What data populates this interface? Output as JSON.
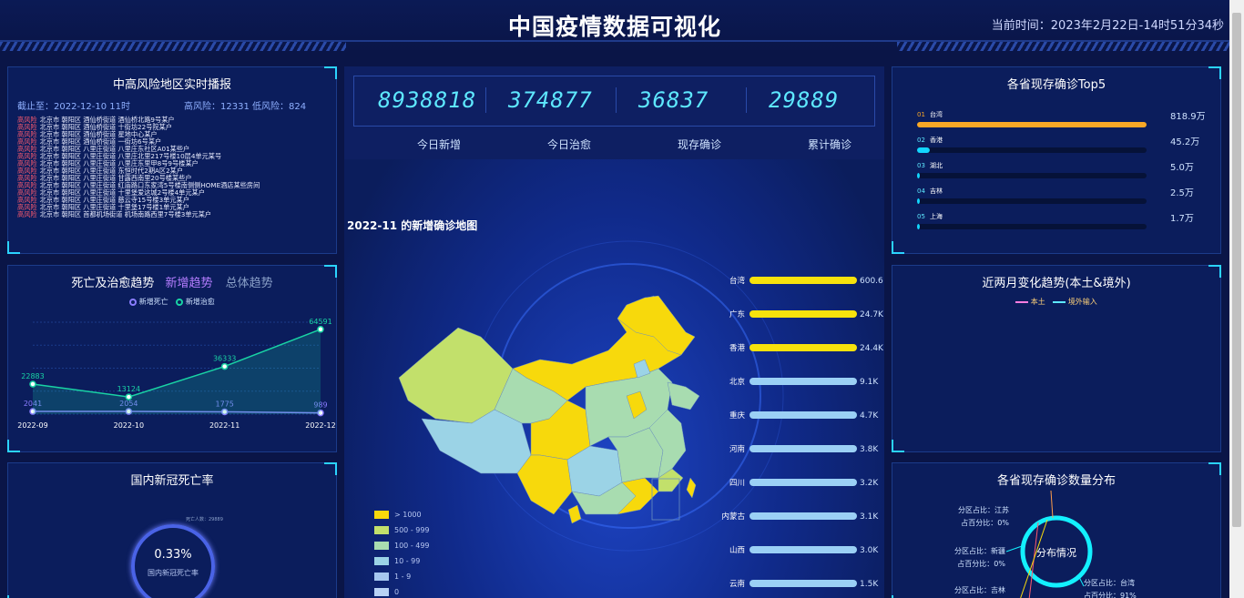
{
  "header": {
    "title": "中国疫情数据可视化",
    "time": "当前时间：2023年2月22日-14时51分34秒"
  },
  "risk": {
    "title": "中高风险地区实时播报",
    "deadline": "截止至：2022-12-10 11时",
    "counts": "高风险：12331 低风险：824",
    "rows": [
      {
        "level": "高风险",
        "place": "北京市 朝阳区 酒仙桥街道 酒仙桥北路9号某户"
      },
      {
        "level": "高风险",
        "place": "北京市 朝阳区 酒仙桥街道 十街坊22号院某户"
      },
      {
        "level": "高风险",
        "place": "北京市 朝阳区 酒仙桥街道 星地中心某户"
      },
      {
        "level": "高风险",
        "place": "北京市 朝阳区 酒仙桥街道 一街坊6号某户"
      },
      {
        "level": "高风险",
        "place": "北京市 朝阳区 八里庄街道 八里庄东社区A01某些户"
      },
      {
        "level": "高风险",
        "place": "北京市 朝阳区 八里庄街道 八里庄北里217号楼10层4单元某号"
      },
      {
        "level": "高风险",
        "place": "北京市 朝阳区 八里庄街道 八里庄东里甲8号9号楼某户"
      },
      {
        "level": "高风险",
        "place": "北京市 朝阳区 八里庄街道 东恒时代2期A区2某户"
      },
      {
        "level": "高风险",
        "place": "北京市 朝阳区 八里庄街道 甘露西南里20号楼某些户"
      },
      {
        "level": "高风险",
        "place": "北京市 朝阳区 八里庄街道 红庙路口东家湾5号楼南侧侧HOME酒店某些房间"
      },
      {
        "level": "高风险",
        "place": "北京市 朝阳区 八里庄街道 十里堡爱这城2号楼4单元某户"
      },
      {
        "level": "高风险",
        "place": "北京市 朝阳区 八里庄街道 慈云寺15号楼3单元某户"
      },
      {
        "level": "高风险",
        "place": "北京市 朝阳区 八里庄街道 十里堡17号楼1单元某户"
      },
      {
        "level": "高风险",
        "place": "北京市 朝阳区 首都机场街道 机场南路西里7号楼3单元某户"
      }
    ]
  },
  "trend": {
    "title": "死亡及治愈趋势",
    "tab_new": "新增趋势",
    "tab_total": "总体趋势",
    "legend": [
      "新增死亡",
      "新增治愈"
    ],
    "colors": {
      "death": "#8a7dff",
      "cure": "#19d3a4"
    }
  },
  "chart_data": [
    {
      "type": "line",
      "categories": [
        "2022-09",
        "2022-10",
        "2022-11",
        "2022-12"
      ],
      "series": [
        {
          "name": "新增死亡",
          "values": [
            2041,
            2054,
            1775,
            989
          ]
        },
        {
          "name": "新增治愈",
          "values": [
            22883,
            13124,
            36333,
            64591
          ]
        }
      ],
      "ylim": [
        0,
        70000
      ]
    },
    {
      "type": "bar",
      "categories": [
        "台湾",
        "广东",
        "香港",
        "北京",
        "重庆",
        "河南",
        "四川",
        "内蒙古",
        "山西",
        "云南"
      ],
      "values": [
        600.6,
        24.7,
        24.4,
        9.1,
        4.7,
        3.8,
        3.2,
        3.1,
        3.0,
        1.5
      ],
      "labels": [
        "600.6l",
        "24.7K",
        "24.4K",
        "9.1K",
        "4.7K",
        "3.8K",
        "3.2K",
        "3.1K",
        "3.0K",
        "1.5K"
      ]
    },
    {
      "type": "bar",
      "title": "各省现存确诊Top5",
      "categories": [
        "台湾",
        "香港",
        "湖北",
        "吉林",
        "上海"
      ],
      "values": [
        818.9,
        45.2,
        5.0,
        2.5,
        1.7
      ],
      "labels": [
        "818.9万",
        "45.2万",
        "5.0万",
        "2.5万",
        "1.7万"
      ],
      "ranks": [
        "01",
        "02",
        "03",
        "04",
        "05"
      ]
    }
  ],
  "mortality": {
    "title": "国内新冠死亡率",
    "value": "0.33%",
    "label": "国内新冠死亡率",
    "note": "死亡人数：29889"
  },
  "stats": [
    {
      "value": "8938818",
      "label": "今日新增"
    },
    {
      "value": "374877",
      "label": "今日治愈"
    },
    {
      "value": "36837",
      "label": "现存确诊"
    },
    {
      "value": "29889",
      "label": "累计确诊"
    }
  ],
  "map": {
    "title": "2022-11 的新增确诊地图",
    "legend": [
      {
        "label": "> 1000",
        "color": "#f7d90c"
      },
      {
        "label": "500 - 999",
        "color": "#c2e06b"
      },
      {
        "label": "100 - 499",
        "color": "#a8dcb0"
      },
      {
        "label": "10 - 99",
        "color": "#9bd3e6"
      },
      {
        "label": "1 - 9",
        "color": "#a6c7ef"
      },
      {
        "label": "0",
        "color": "#b8d2f5"
      }
    ]
  },
  "change": {
    "title": "近两月变化趋势(本土&境外)",
    "legend": [
      "本土",
      "境外输入"
    ]
  },
  "distribution": {
    "title": "各省现存确诊数量分布",
    "center": "分布情况",
    "labels": [
      {
        "name": "分区占比：江苏",
        "pct": "占百分比：0%"
      },
      {
        "name": "分区占比：新疆",
        "pct": "占百分比：0%"
      },
      {
        "name": "分区占比：吉林",
        "pct": ""
      },
      {
        "name": "分区占比：台湾",
        "pct": "占百分比：91%"
      }
    ]
  }
}
